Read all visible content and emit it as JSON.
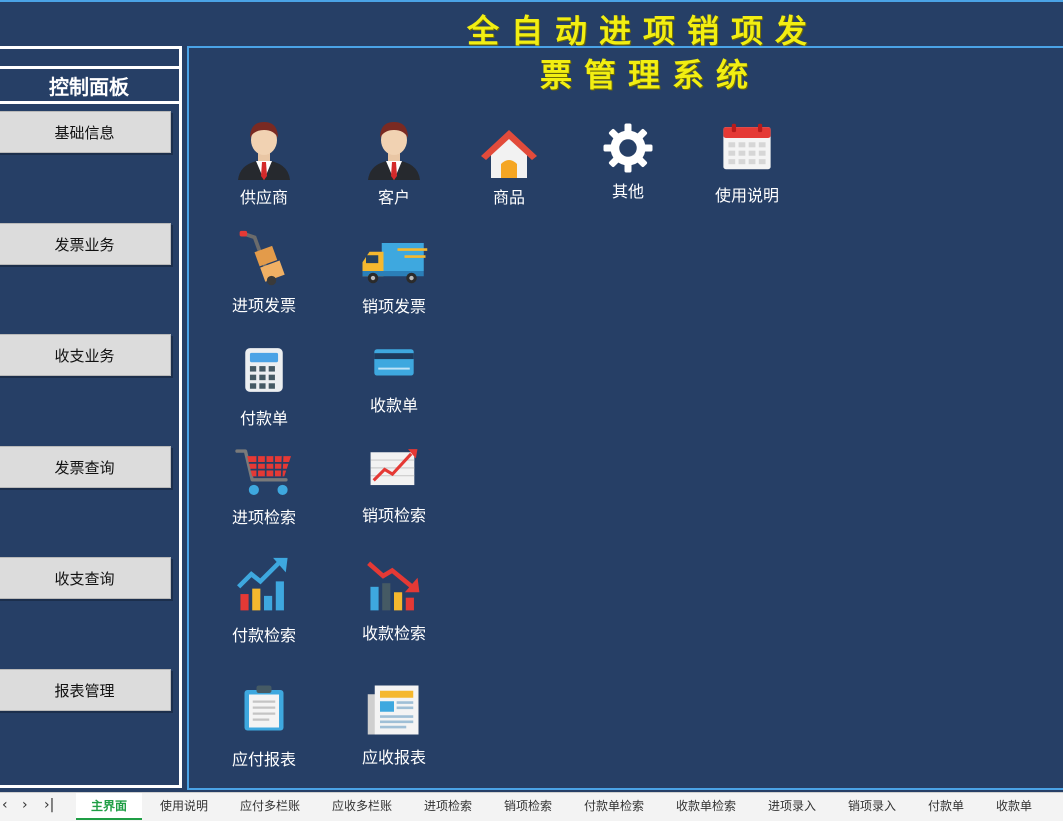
{
  "title": {
    "line1": "全自动进项销项发",
    "line2": "票管理系统"
  },
  "sidebar": {
    "header": "控制面板",
    "buttons": [
      "基础信息",
      "发票业务",
      "收支业务",
      "发票查询",
      "收支查询",
      "报表管理"
    ]
  },
  "tiles": {
    "supplier": "供应商",
    "customer": "客户",
    "product": "商品",
    "other": "其他",
    "manual": "使用说明",
    "purchase_invoice": "进项发票",
    "sales_invoice": "销项发票",
    "payment_voucher": "付款单",
    "receipt_voucher": "收款单",
    "purchase_search": "进项检索",
    "sales_search": "销项检索",
    "payment_search": "付款检索",
    "receipt_search": "收款检索",
    "payable_report": "应付报表",
    "receivable_report": "应收报表"
  },
  "sheet_tabs": [
    "主界面",
    "使用说明",
    "应付多栏账",
    "应收多栏账",
    "进项检索",
    "销项检索",
    "付款单检索",
    "收款单检索",
    "进项录入",
    "销项录入",
    "付款单",
    "收款单"
  ],
  "colors": {
    "background": "#263f66",
    "title": "#f2ee12",
    "accent": "#4aa3e6",
    "active_tab": "#1f9e45"
  }
}
